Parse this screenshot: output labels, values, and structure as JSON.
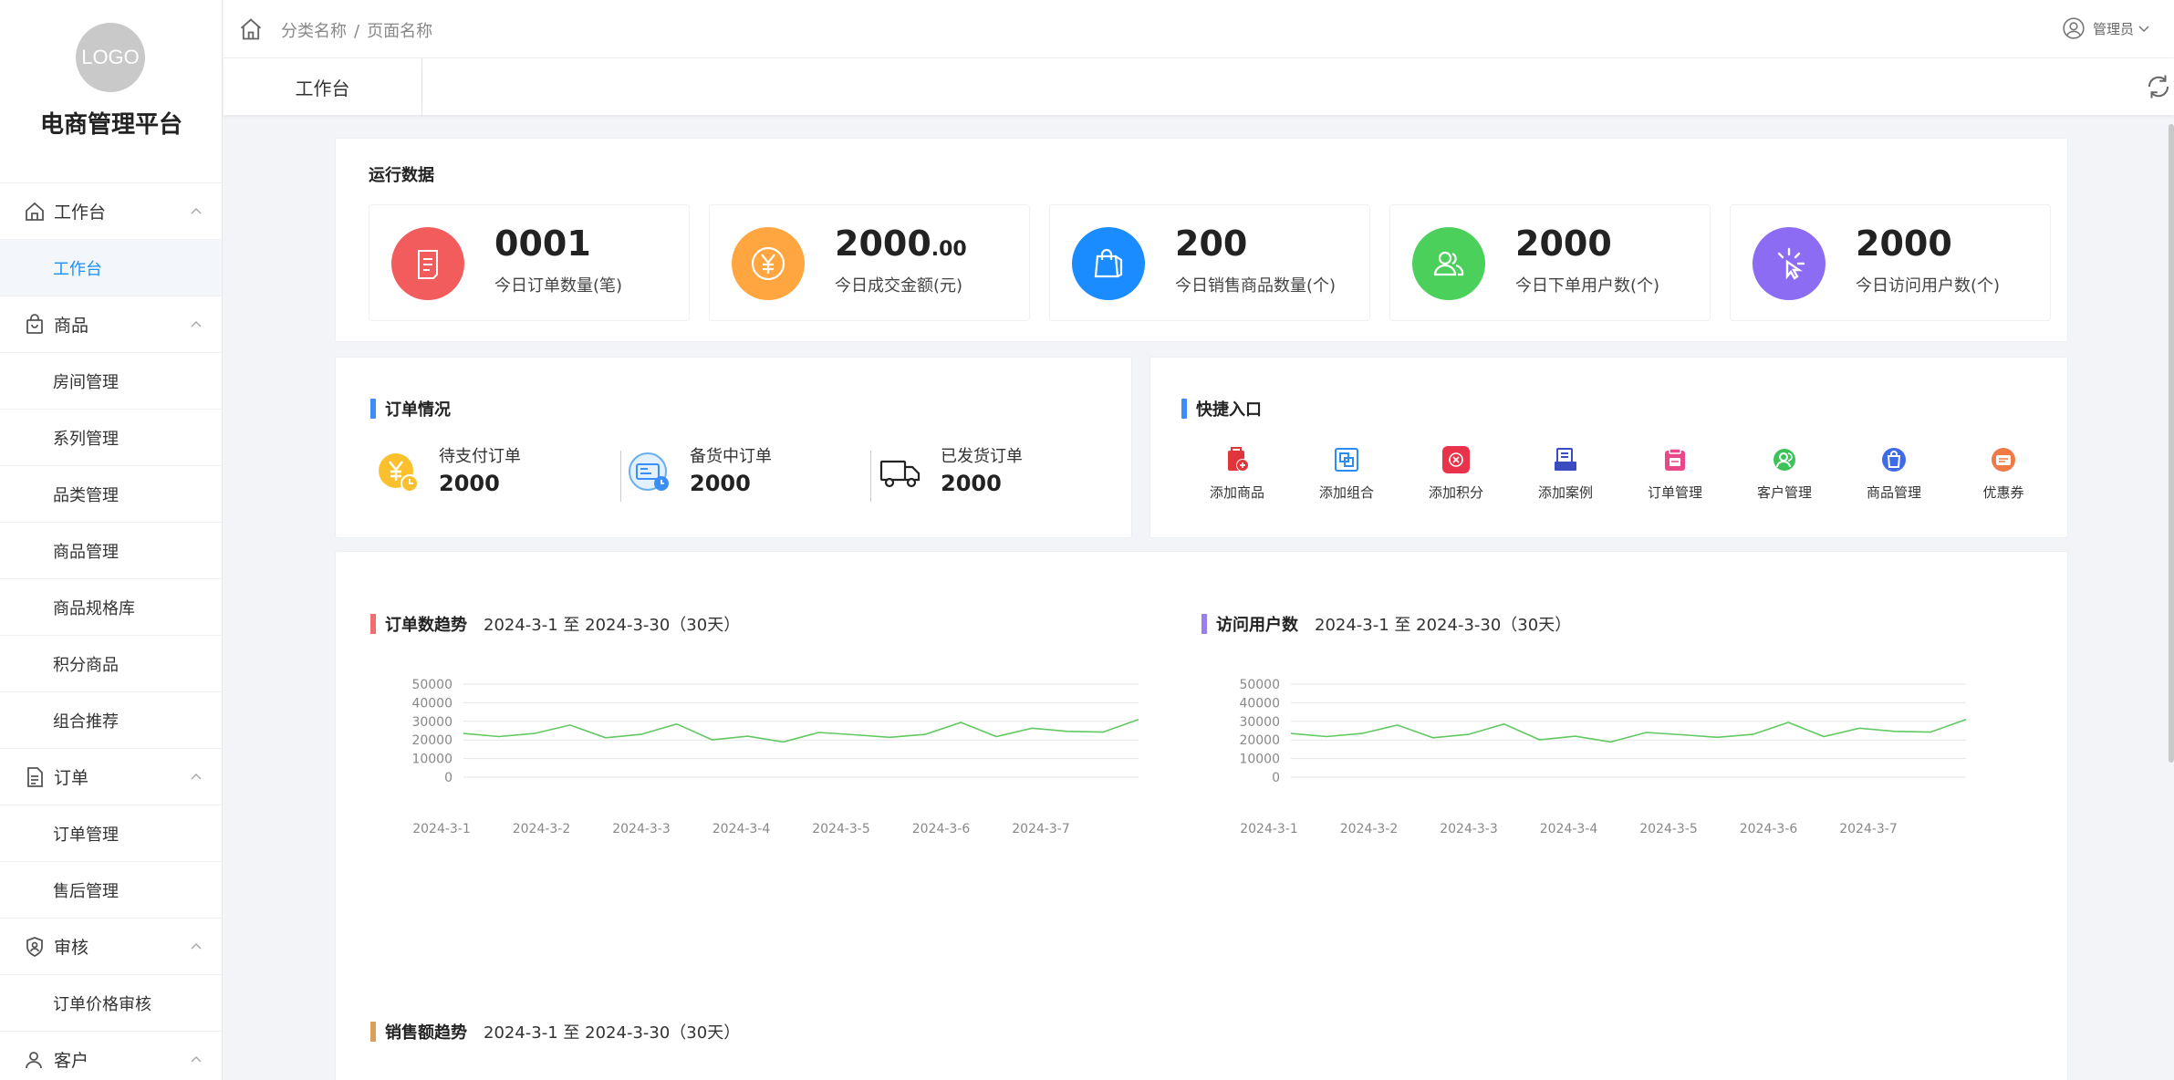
{
  "sidebar": {
    "logo": "LOGO",
    "brand": "电商管理平台",
    "groups": [
      {
        "title": "工作台",
        "icon": "home-icon",
        "items": [
          "工作台"
        ]
      },
      {
        "title": "商品",
        "icon": "bag-icon",
        "items": [
          "房间管理",
          "系列管理",
          "品类管理",
          "商品管理",
          "商品规格库",
          "积分商品",
          "组合推荐"
        ]
      },
      {
        "title": "订单",
        "icon": "document-icon",
        "items": [
          "订单管理",
          "售后管理"
        ]
      },
      {
        "title": "审核",
        "icon": "shield-icon",
        "items": [
          "订单价格审核"
        ]
      },
      {
        "title": "客户",
        "icon": "user-icon",
        "items": []
      }
    ],
    "active_item": "工作台"
  },
  "topbar": {
    "breadcrumb": [
      "分类名称",
      "/",
      "页面名称"
    ],
    "user": "管理员"
  },
  "tabs": [
    "工作台"
  ],
  "run_data": {
    "title": "运行数据",
    "stats": [
      {
        "value": "0001",
        "decimal": "",
        "label": "今日订单数量(笔)",
        "color": "#f25c5c",
        "icon": "order-list-icon"
      },
      {
        "value": "2000",
        "decimal": ".00",
        "label": "今日成交金额(元)",
        "color": "#ffa640",
        "icon": "yuan-icon"
      },
      {
        "value": "200",
        "decimal": "",
        "label": "今日销售商品数量(个)",
        "color": "#1a8cff",
        "icon": "shopping-bag-icon"
      },
      {
        "value": "2000",
        "decimal": "",
        "label": "今日下单用户数(个)",
        "color": "#4cd05c",
        "icon": "users-icon"
      },
      {
        "value": "2000",
        "decimal": "",
        "label": "今日访问用户数(个)",
        "color": "#8c6cf2",
        "icon": "click-icon"
      }
    ]
  },
  "order_status": {
    "title": "订单情况",
    "items": [
      {
        "label": "待支付订单",
        "value": "2000",
        "icon": "pending-payment-icon"
      },
      {
        "label": "备货中订单",
        "value": "2000",
        "icon": "stocking-icon"
      },
      {
        "label": "已发货订单",
        "value": "2000",
        "icon": "truck-icon"
      }
    ]
  },
  "quick_entry": {
    "title": "快捷入口",
    "items": [
      {
        "label": "添加商品",
        "icon": "add-product-icon",
        "color": "#e0353b"
      },
      {
        "label": "添加组合",
        "icon": "add-combo-icon",
        "color": "#2d8cf0"
      },
      {
        "label": "添加积分",
        "icon": "add-points-icon",
        "color": "#e8334a"
      },
      {
        "label": "添加案例",
        "icon": "add-case-icon",
        "color": "#3b4cc0"
      },
      {
        "label": "订单管理",
        "icon": "order-manage-icon",
        "color": "#e9478a"
      },
      {
        "label": "客户管理",
        "icon": "customer-manage-icon",
        "color": "#3cc45a"
      },
      {
        "label": "商品管理",
        "icon": "product-manage-icon",
        "color": "#3f6ae8"
      },
      {
        "label": "优惠券",
        "icon": "coupon-icon",
        "color": "#f07a45"
      }
    ]
  },
  "charts_section": {
    "sales_title": "销售额趋势",
    "sales_range": "2024-3-1 至 2024-3-30（30天）",
    "sales_color": "#d9a05b"
  },
  "chart_data": [
    {
      "type": "line",
      "title": "订单数趋势",
      "range": "2024-3-1 至 2024-3-30（30天）",
      "title_color": "#f26d6d",
      "line_color": "#62c862",
      "ylim": [
        0,
        50000
      ],
      "yticks": [
        0,
        10000,
        20000,
        30000,
        40000,
        50000
      ],
      "xticks": [
        "2024-3-1",
        "2024-3-2",
        "2024-3-3",
        "2024-3-4",
        "2024-3-5",
        "2024-3-6",
        "2024-3-7"
      ],
      "values": [
        23500,
        21800,
        23500,
        28000,
        21200,
        23000,
        28600,
        20100,
        22000,
        18900,
        24000,
        22800,
        21400,
        23000,
        29400,
        21800,
        26300,
        24600,
        24200,
        31000
      ],
      "grid": true
    },
    {
      "type": "line",
      "title": "访问用户数",
      "range": "2024-3-1 至 2024-3-30（30天）",
      "title_color": "#9b7ef0",
      "line_color": "#62c862",
      "ylim": [
        0,
        50000
      ],
      "yticks": [
        0,
        10000,
        20000,
        30000,
        40000,
        50000
      ],
      "xticks": [
        "2024-3-1",
        "2024-3-2",
        "2024-3-3",
        "2024-3-4",
        "2024-3-5",
        "2024-3-6",
        "2024-3-7"
      ],
      "values": [
        23500,
        21800,
        23500,
        28000,
        21200,
        23000,
        28600,
        20100,
        22000,
        18900,
        24000,
        22800,
        21400,
        23000,
        29400,
        21800,
        26300,
        24600,
        24200,
        31000
      ],
      "grid": true
    }
  ]
}
